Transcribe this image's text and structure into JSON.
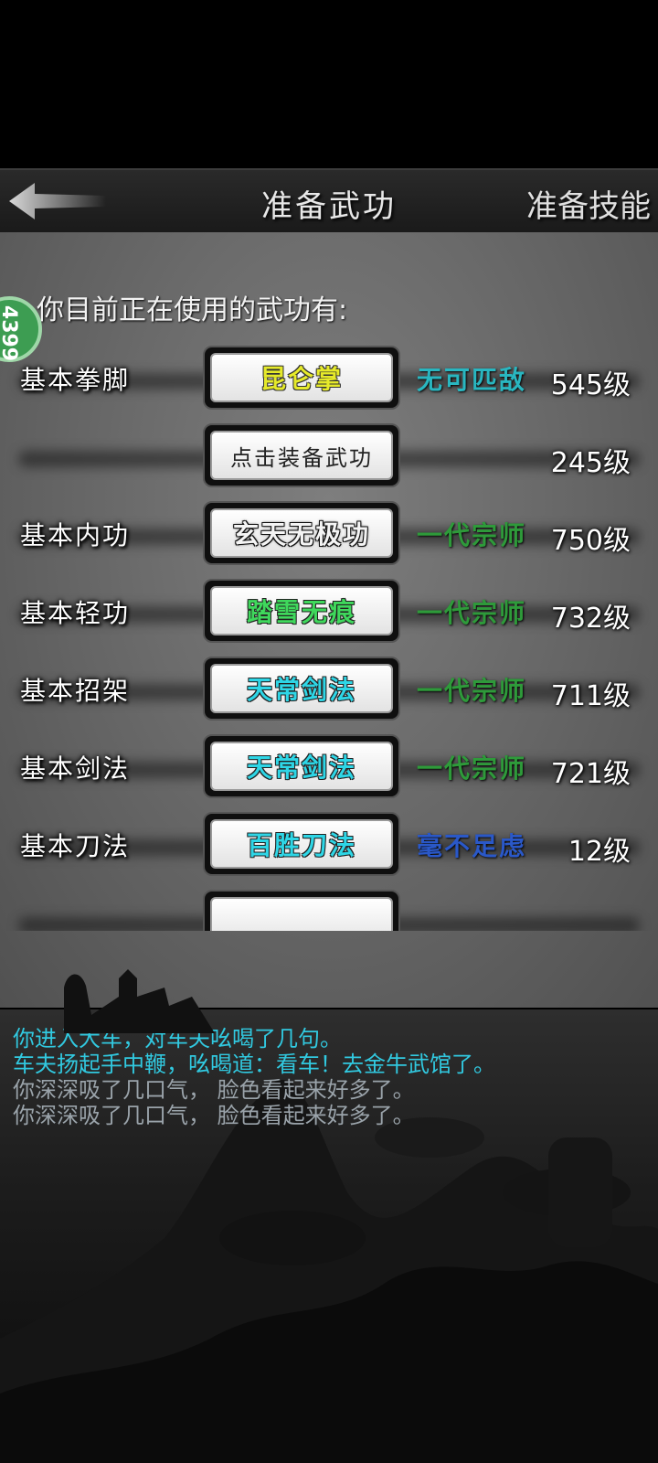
{
  "header": {
    "title": "准备武功",
    "right_button": "准备技能"
  },
  "notice": "你目前正在使用的武功有:",
  "badge": "4399",
  "rows": [
    {
      "category": "基本拳脚",
      "skill": "昆仑掌",
      "skill_color": "#e6ea2a",
      "rank": "无可匹敌",
      "rank_color": "#29b6c0",
      "level": "545级"
    },
    {
      "category": "",
      "skill": "点击装备武功",
      "skill_color": "#222222",
      "rank": "",
      "rank_color": "",
      "level": "245级"
    },
    {
      "category": "基本内功",
      "skill": "玄天无极功",
      "skill_color": "#f4f4f4",
      "rank": "一代宗师",
      "rank_color": "#2e9a3a",
      "level": "750级"
    },
    {
      "category": "基本轻功",
      "skill": "踏雪无痕",
      "skill_color": "#3fd85c",
      "rank": "一代宗师",
      "rank_color": "#2e9a3a",
      "level": "732级"
    },
    {
      "category": "基本招架",
      "skill": "天常剑法",
      "skill_color": "#2ed6e6",
      "rank": "一代宗师",
      "rank_color": "#2e9a3a",
      "level": "711级"
    },
    {
      "category": "基本剑法",
      "skill": "天常剑法",
      "skill_color": "#2ed6e6",
      "rank": "一代宗师",
      "rank_color": "#2e9a3a",
      "level": "721级"
    },
    {
      "category": "基本刀法",
      "skill": "百胜刀法",
      "skill_color": "#2ed6e6",
      "rank": "毫不足虑",
      "rank_color": "#2a58c8",
      "level": "12级"
    },
    {
      "category": "",
      "skill": "",
      "skill_color": "#222222",
      "rank": "",
      "rank_color": "",
      "level": ""
    }
  ],
  "log": [
    {
      "text": "你进入大车，对车夫吆喝了几句。",
      "color": "#31c9e0"
    },
    {
      "text": "车夫扬起手中鞭，吆喝道：看车！去金牛武馆了。",
      "color": "#31c9e0"
    },
    {
      "text": "你深深吸了几口气， 脸色看起来好多了。",
      "color": "#9aa3aa"
    },
    {
      "text": "你深深吸了几口气， 脸色看起来好多了。",
      "color": "#9aa3aa"
    }
  ]
}
